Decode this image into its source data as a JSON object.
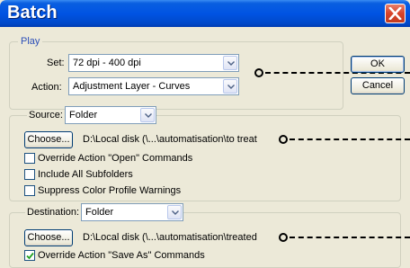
{
  "window": {
    "title": "Batch"
  },
  "play": {
    "legend": "Play",
    "set_label": "Set:",
    "set_value": "72 dpi - 400 dpi",
    "action_label": "Action:",
    "action_value": "Adjustment Layer - Curves"
  },
  "buttons": {
    "ok": "OK",
    "cancel": "Cancel"
  },
  "source": {
    "label": "Source:",
    "value": "Folder",
    "choose_label": "Choose...",
    "path": "D:\\Local disk (\\...\\automatisation\\to treat",
    "options": [
      {
        "label": "Override Action \"Open\" Commands",
        "checked": false
      },
      {
        "label": "Include All Subfolders",
        "checked": false
      },
      {
        "label": "Suppress Color Profile Warnings",
        "checked": false
      }
    ]
  },
  "destination": {
    "label": "Destination:",
    "value": "Folder",
    "choose_label": "Choose...",
    "path": "D:\\Local disk (\\...\\automatisation\\treated",
    "options": [
      {
        "label": "Override Action \"Save As\" Commands",
        "checked": true
      }
    ]
  }
}
